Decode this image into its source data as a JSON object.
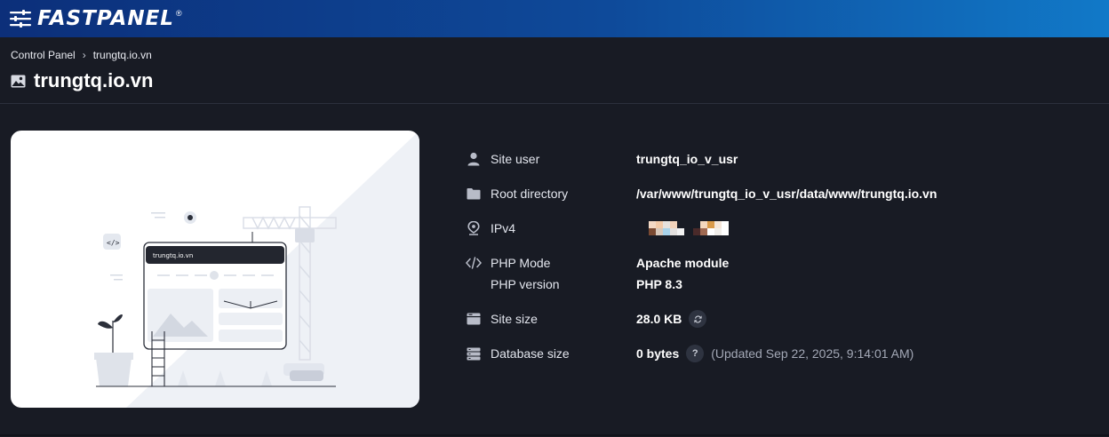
{
  "app": {
    "brand": "FASTPANEL",
    "reg_mark": "®"
  },
  "breadcrumb": {
    "root": "Control Panel",
    "current": "trungtq.io.vn"
  },
  "page_title": "trungtq.io.vn",
  "illustration": {
    "screen_label": "trungtq.io.vn"
  },
  "info": {
    "site_user": {
      "label": "Site user",
      "value": "trungtq_io_v_usr",
      "icon": "user-icon"
    },
    "root_directory": {
      "label": "Root directory",
      "value": "/var/www/trungtq_io_v_usr/data/www/trungtq.io.vn",
      "icon": "folder-icon"
    },
    "ipv4": {
      "label": "IPv4",
      "icon": "location-pin-icon"
    },
    "php_mode": {
      "label": "PHP Mode",
      "value": "Apache module",
      "icon": "code-icon"
    },
    "php_version": {
      "label": "PHP version",
      "value": "PHP 8.3"
    },
    "site_size": {
      "label": "Site size",
      "value": "28.0 KB",
      "icon": "hdd-icon",
      "action_icon": "refresh-icon"
    },
    "database_size": {
      "label": "Database size",
      "value": "0 bytes",
      "help": "?",
      "updated": "(Updated Sep 22, 2025, 9:14:01 AM)",
      "icon": "database-icon"
    }
  },
  "colors": {
    "topbar_start": "#0c2f7a",
    "topbar_end": "#1179c8",
    "background": "#181b24"
  }
}
